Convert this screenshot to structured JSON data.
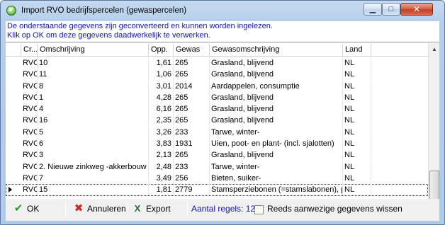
{
  "window": {
    "title": "Import RVO bedrijfspercelen (gewaspercelen)",
    "min_label": "▁",
    "max_label": "□",
    "close_label": "✕"
  },
  "message": {
    "line1": "De onderstaande gegevens zijn geconverteerd en kunnen worden ingelezen.",
    "line2": "Klik op OK om deze gegevens daadwerkelijk te verwerken."
  },
  "grid": {
    "columns": [
      "Cr...",
      "Omschrijving",
      "Opp.",
      "Gewas",
      "Gewasomschrijving",
      "Land"
    ],
    "rows": [
      {
        "cr": "RVO",
        "omschrijving": "10",
        "opp": "1,61",
        "gewas": "265",
        "gewasomschrijving": "Grasland, blijvend",
        "land": "NL"
      },
      {
        "cr": "RVO",
        "omschrijving": "11",
        "opp": "1,06",
        "gewas": "265",
        "gewasomschrijving": "Grasland, blijvend",
        "land": "NL"
      },
      {
        "cr": "RVO",
        "omschrijving": "8",
        "opp": "3,01",
        "gewas": "2014",
        "gewasomschrijving": "Aardappelen, consumptie",
        "land": "NL"
      },
      {
        "cr": "RVO",
        "omschrijving": "1",
        "opp": "4,28",
        "gewas": "265",
        "gewasomschrijving": "Grasland, blijvend",
        "land": "NL"
      },
      {
        "cr": "RVO",
        "omschrijving": "4",
        "opp": "6,16",
        "gewas": "265",
        "gewasomschrijving": "Grasland, blijvend",
        "land": "NL"
      },
      {
        "cr": "RVO",
        "omschrijving": "16",
        "opp": "2,35",
        "gewas": "265",
        "gewasomschrijving": "Grasland, blijvend",
        "land": "NL"
      },
      {
        "cr": "RVO",
        "omschrijving": "5",
        "opp": "3,26",
        "gewas": "233",
        "gewasomschrijving": "Tarwe, winter-",
        "land": "NL"
      },
      {
        "cr": "RVO",
        "omschrijving": "6",
        "opp": "3,83",
        "gewas": "1931",
        "gewasomschrijving": "Uien, poot- en plant- (incl. sjalotten)",
        "land": "NL"
      },
      {
        "cr": "RVO",
        "omschrijving": "3",
        "opp": "2,13",
        "gewas": "265",
        "gewasomschrijving": "Grasland, blijvend",
        "land": "NL"
      },
      {
        "cr": "RVO",
        "omschrijving": "2. Nieuwe zinkweg -akkerbouw",
        "opp": "2,48",
        "gewas": "233",
        "gewasomschrijving": "Tarwe, winter-",
        "land": "NL"
      },
      {
        "cr": "RVO",
        "omschrijving": "7",
        "opp": "3,49",
        "gewas": "256",
        "gewasomschrijving": "Bieten, suiker-",
        "land": "NL"
      },
      {
        "cr": "RVO",
        "omschrijving": "15",
        "opp": "1,81",
        "gewas": "2779",
        "gewasomschrijving": "Stamsperziebonen (=stamslabonen), pr",
        "land": "NL",
        "selected": true
      }
    ]
  },
  "toolbar": {
    "ok_label": "OK",
    "cancel_label": "Annuleren",
    "export_label": "Export",
    "count_text": "Aantal regels: 12",
    "existing_label": "Reeds aanwezige gegevens wissen"
  },
  "icons": {
    "app": "check-circle-icon",
    "ok": "check-icon",
    "cancel": "x-icon",
    "export": "excel-icon"
  },
  "colors": {
    "message_text": "#1515a8",
    "close_button": "#c13f24"
  }
}
